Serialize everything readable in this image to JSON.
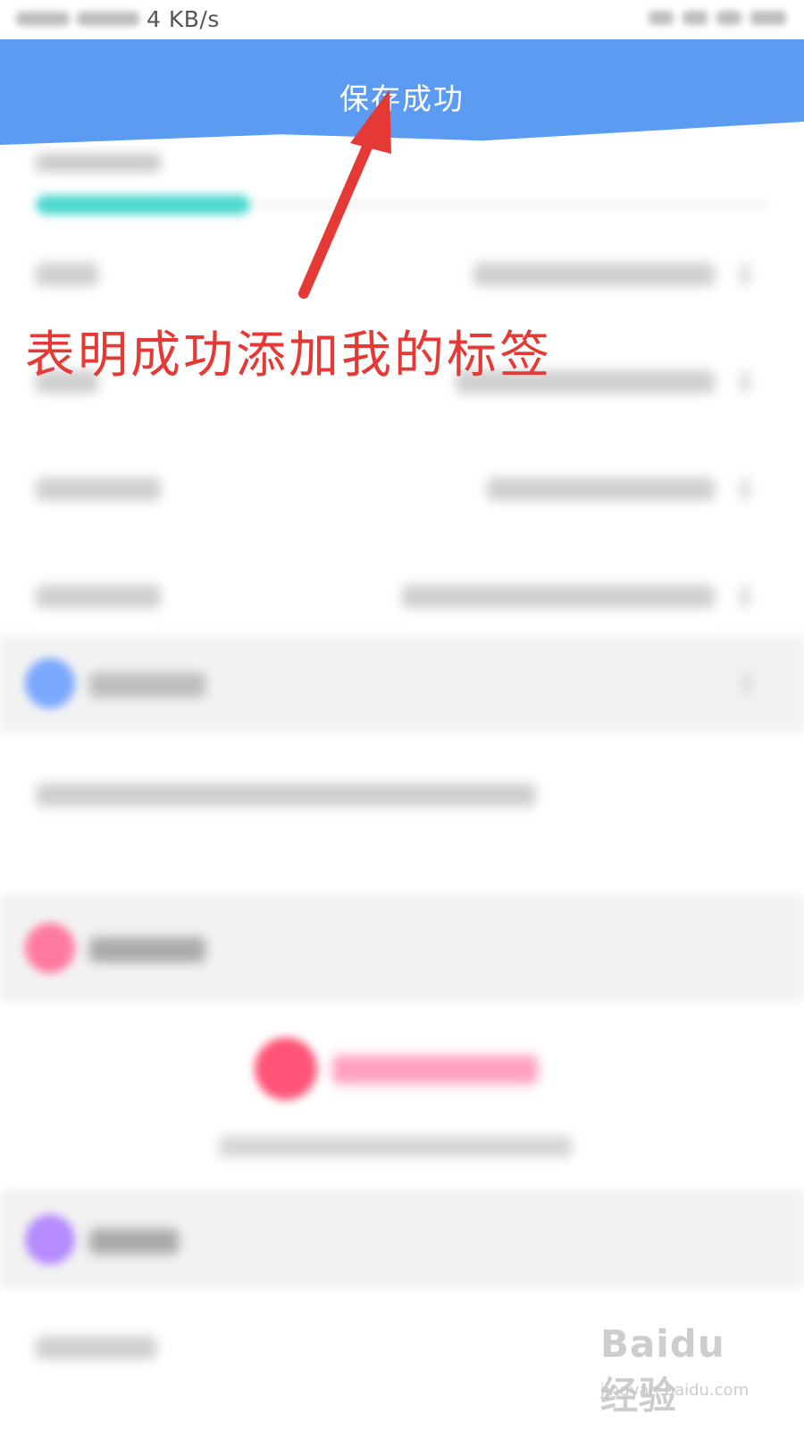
{
  "status_bar": {
    "net_speed": "4 KB/s"
  },
  "toast": {
    "message": "保存成功"
  },
  "annotation": {
    "text": "表明成功添加我的标签",
    "color": "#e53935"
  },
  "colors": {
    "toast_bg": "#5b9bf2",
    "progress_fill": "#4fd9cf",
    "intro_icon": "#7aa8ff",
    "tags_icon": "#ff7aa0",
    "add_tag_button": "#ff5477",
    "certify_icon": "#b58bff"
  },
  "watermark": {
    "brand": "Baidu经验",
    "url": "jingyan.baidu.com"
  }
}
